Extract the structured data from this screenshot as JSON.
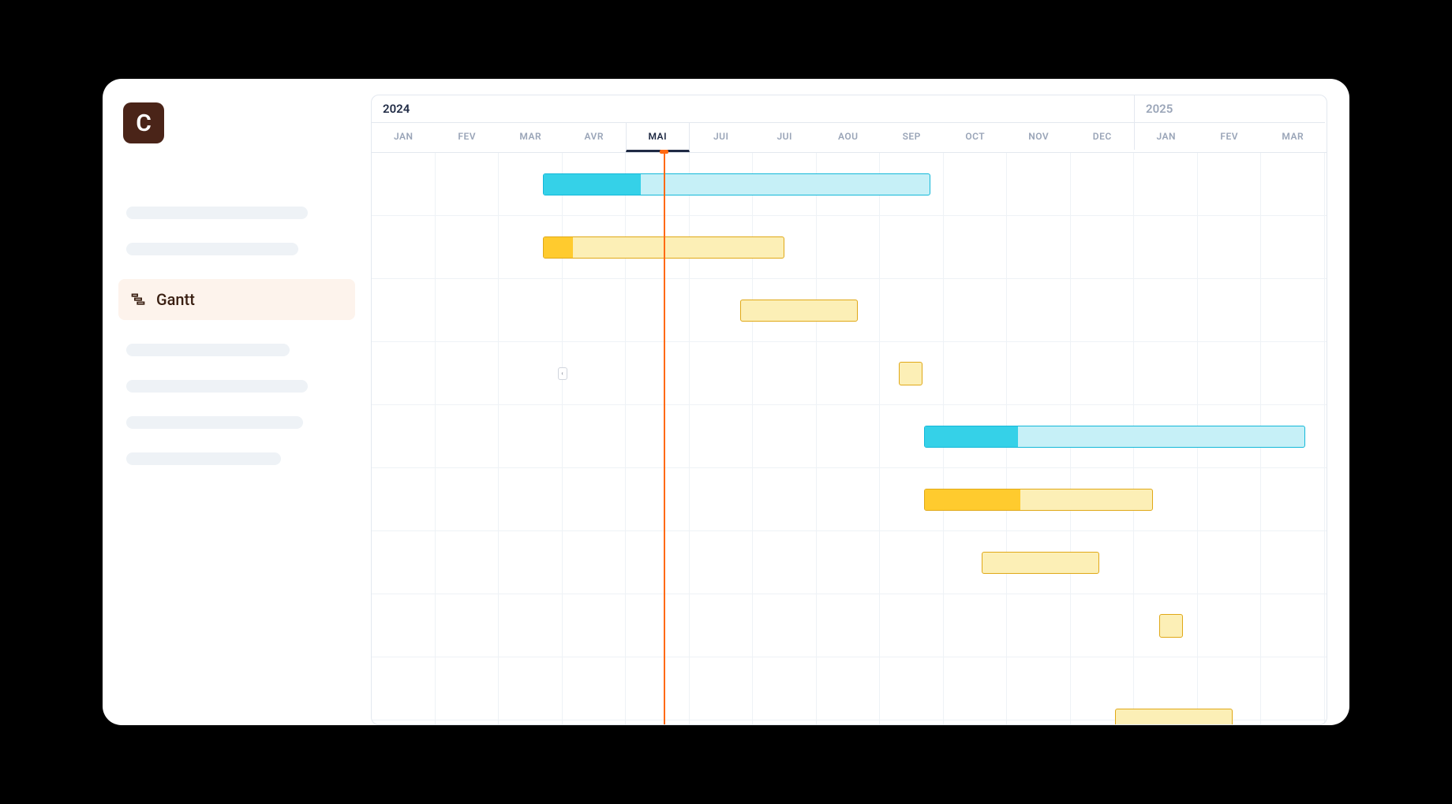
{
  "app": {
    "logo_letter": "C"
  },
  "sidebar": {
    "active_item": {
      "label": "Gantt"
    }
  },
  "timeline": {
    "years": [
      {
        "label": "2024",
        "months": [
          "JAN",
          "FEV",
          "MAR",
          "AVR",
          "MAI",
          "JUI",
          "JUI",
          "AOU",
          "SEP",
          "OCT",
          "NOV",
          "DEC"
        ],
        "secondary": false
      },
      {
        "label": "2025",
        "months": [
          "JAN",
          "FEV",
          "MAR"
        ],
        "secondary": true
      }
    ],
    "current_month_index": 4,
    "today_col": 4.6,
    "colors": {
      "cyan_border": "#13b8d9",
      "cyan_fill": "#35d1e8",
      "cyan_light": "#c6f0f7",
      "yellow_border": "#e0a817",
      "yellow_fill_dark": "#ffcb2e",
      "yellow_fill_light": "#fcefb6"
    },
    "bars": [
      {
        "row": 0,
        "start_col": 2.7,
        "span_cols": 6.1,
        "style": "cyan",
        "progress": 0.25
      },
      {
        "row": 1,
        "start_col": 2.7,
        "span_cols": 3.8,
        "style": "yellow",
        "progress": 0.12
      },
      {
        "row": 2,
        "start_col": 5.8,
        "span_cols": 1.85,
        "style": "yellow",
        "progress": 0
      },
      {
        "row": 3,
        "start_col": 8.3,
        "span_cols": 0.35,
        "style": "yellow",
        "progress": 0,
        "square": true
      },
      {
        "row": 4,
        "start_col": 8.7,
        "span_cols": 6.0,
        "style": "cyan",
        "progress": 0.245
      },
      {
        "row": 5,
        "start_col": 8.7,
        "span_cols": 3.6,
        "style": "yellow",
        "progress": 0.42
      },
      {
        "row": 6,
        "start_col": 9.6,
        "span_cols": 1.85,
        "style": "yellow",
        "progress": 0
      },
      {
        "row": 7,
        "start_col": 12.4,
        "span_cols": 0.35,
        "style": "yellow",
        "progress": 0,
        "square": true
      },
      {
        "row": 8,
        "start_col": 11.7,
        "span_cols": 1.85,
        "style": "yellow",
        "progress": 0,
        "clip_bottom": true
      }
    ],
    "expand_handle": {
      "row": 3,
      "col": 3.0,
      "glyph": "‹"
    }
  },
  "chart_data": {
    "type": "gantt",
    "title": "",
    "x_axis": {
      "unit": "months",
      "columns": [
        "2024-01",
        "2024-02",
        "2024-03",
        "2024-04",
        "2024-05",
        "2024-06",
        "2024-07",
        "2024-08",
        "2024-09",
        "2024-10",
        "2024-11",
        "2024-12",
        "2025-01",
        "2025-02",
        "2025-03"
      ],
      "current": "2024-05"
    },
    "tasks": [
      {
        "row": 1,
        "start": "2024-03",
        "end": "2024-09",
        "color": "cyan",
        "progress_pct": 25
      },
      {
        "row": 2,
        "start": "2024-03",
        "end": "2024-07",
        "color": "yellow",
        "progress_pct": 12
      },
      {
        "row": 3,
        "start": "2024-07",
        "end": "2024-09",
        "color": "yellow",
        "progress_pct": 0
      },
      {
        "row": 4,
        "start": "2024-09",
        "end": "2024-09",
        "color": "yellow",
        "progress_pct": 0,
        "milestone": true
      },
      {
        "row": 5,
        "start": "2024-10",
        "end": "2025-03",
        "color": "cyan",
        "progress_pct": 25
      },
      {
        "row": 6,
        "start": "2024-10",
        "end": "2025-01",
        "color": "yellow",
        "progress_pct": 42
      },
      {
        "row": 7,
        "start": "2024-11",
        "end": "2024-12",
        "color": "yellow",
        "progress_pct": 0
      },
      {
        "row": 8,
        "start": "2025-02",
        "end": "2025-02",
        "color": "yellow",
        "progress_pct": 0,
        "milestone": true
      },
      {
        "row": 9,
        "start": "2024-12",
        "end": "2025-02",
        "color": "yellow",
        "progress_pct": 0
      }
    ]
  }
}
